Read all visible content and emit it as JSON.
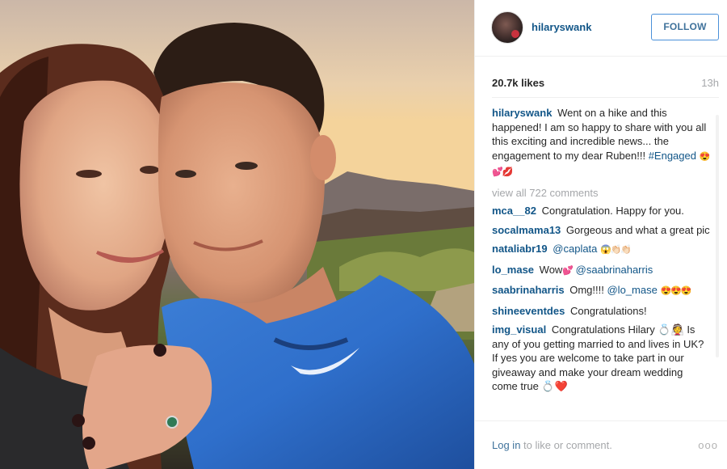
{
  "post": {
    "username": "hilaryswank",
    "follow_label": "FOLLOW",
    "likes": "20.7k likes",
    "time": "13h"
  },
  "caption": {
    "user": "hilaryswank",
    "text": "Went on a hike and this happened! I am so happy to share with you all this exciting and incredible news... the engagement to my dear Ruben!!!",
    "hashtag": "#Engaged",
    "emoji": "😍💕💋"
  },
  "view_all_comments": "view all 722 comments",
  "comments": [
    {
      "user": "mca__82",
      "text": "Congratulation. Happy for you."
    },
    {
      "user": "socalmama13",
      "text": "Gorgeous and what a great pic"
    },
    {
      "user": "nataliabr19",
      "mention": "@caplata",
      "emoji": "😱👏🏻👏🏻"
    },
    {
      "user": "lo_mase",
      "text": "Wow",
      "emoji": "💕",
      "mention": "@saabrinaharris"
    },
    {
      "user": "saabrinaharris",
      "text": "Omg!!!!",
      "mention": "@lo_mase",
      "emoji": "😍😍😍"
    },
    {
      "user": "shineeventdes",
      "text": "Congratulations!"
    },
    {
      "user": "img_visual",
      "text": "Congratulations Hilary 💍👰 Is any of you getting married to and lives in UK? If yes you are welcome to take part in our giveaway and make your dream wedding come true 💍❤️"
    }
  ],
  "footer": {
    "login_link": "Log in",
    "login_rest": " to like or comment.",
    "more": "ooo"
  },
  "colors": {
    "username_blue": "#125688",
    "follow_blue": "#3f729b",
    "muted_gray": "#a5a7aa"
  },
  "icons": {
    "more": "more-options-icon"
  }
}
